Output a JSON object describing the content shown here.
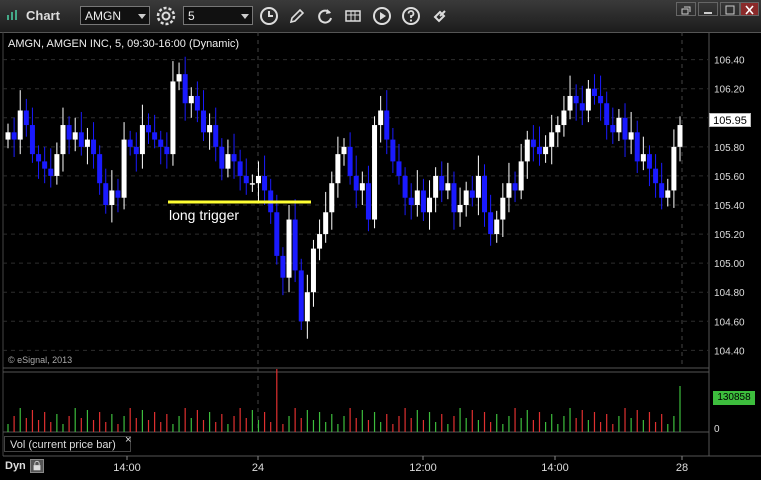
{
  "window": {
    "title": "Chart"
  },
  "toolbar": {
    "symbol": "AMGN",
    "interval": "5",
    "icons": [
      "settings-gear-icon",
      "clock-icon",
      "pencil-icon",
      "refresh-icon",
      "spreadsheet-icon",
      "play-icon",
      "help-icon",
      "link-icon"
    ]
  },
  "chart": {
    "header": "AMGN, AMGEN INC, 5, 09:30-16:00 (Dynamic)",
    "copyright": "© eSignal, 2013",
    "annotation": "long trigger",
    "last_price": "105.95",
    "volume_value": "130858",
    "volume_study_label": "Vol (current price bar)",
    "volume_close": "×",
    "dyn_label": "Dyn",
    "colors": {
      "up": "#ffffff",
      "down": "#1a1aff",
      "trigger": "#ffff33",
      "vol_up": "#3dbd3d",
      "vol_down": "#e03030"
    }
  },
  "chart_data": {
    "type": "candlestick",
    "y_ticks": [
      "106.40",
      "106.20",
      "106.00",
      "105.80",
      "105.60",
      "105.40",
      "105.20",
      "105.00",
      "104.80",
      "104.60",
      "104.40"
    ],
    "ylim": [
      104.32,
      106.48
    ],
    "x_ticks": [
      "14:00",
      "24",
      "12:00",
      "14:00",
      "28"
    ],
    "volume_ticks": [
      "0"
    ],
    "trigger_price": 105.39,
    "trigger_label": "long trigger"
  }
}
